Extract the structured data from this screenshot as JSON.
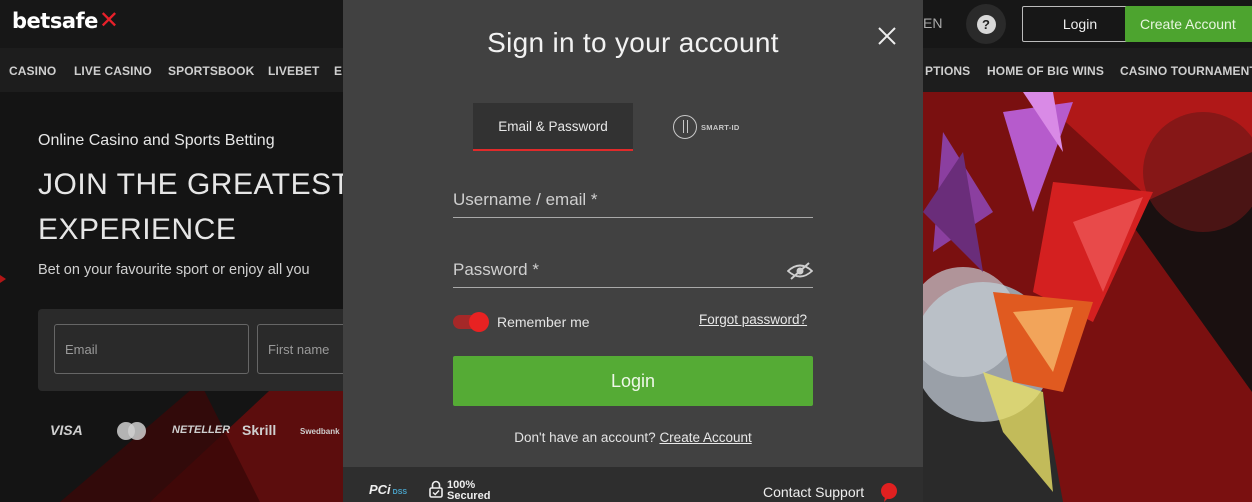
{
  "brand": {
    "logo": "betsafe",
    "accent": "#e8202a",
    "green": "#55ab35"
  },
  "header": {
    "language": "EN",
    "help_icon": "question-icon",
    "login": "Login",
    "create_account": "Create Account"
  },
  "nav": {
    "items": [
      "CASINO",
      "LIVE CASINO",
      "SPORTSBOOK",
      "LIVEBET",
      "E",
      "PTIONS",
      "HOME OF BIG WINS",
      "CASINO TOURNAMENT"
    ]
  },
  "hero": {
    "kicker": "Online Casino and Sports Betting",
    "title_line1": "JOIN THE GREATEST",
    "title_line2": "EXPERIENCE",
    "subtitle": "Bet on your favourite sport or enjoy all you",
    "email_placeholder": "Email",
    "firstname_placeholder": "First name",
    "payments": [
      "VISA",
      "NETELLER",
      "Skrill",
      "Swedbank"
    ]
  },
  "modal": {
    "title": "Sign in to your account",
    "tabs": {
      "email_password": "Email & Password",
      "smart_id": "SMART-ID"
    },
    "username_placeholder": "Username / email *",
    "password_placeholder": "Password *",
    "remember_me": "Remember me",
    "remember_checked": true,
    "forgot_password": "Forgot password?",
    "login_button": "Login",
    "no_account": "Don't have an account?",
    "create_account_link": "Create Account",
    "footer": {
      "pci": "PCi",
      "pci_dss": "DSS",
      "secured_line1": "100%",
      "secured_line2": "Secured",
      "contact_support": "Contact Support"
    }
  }
}
